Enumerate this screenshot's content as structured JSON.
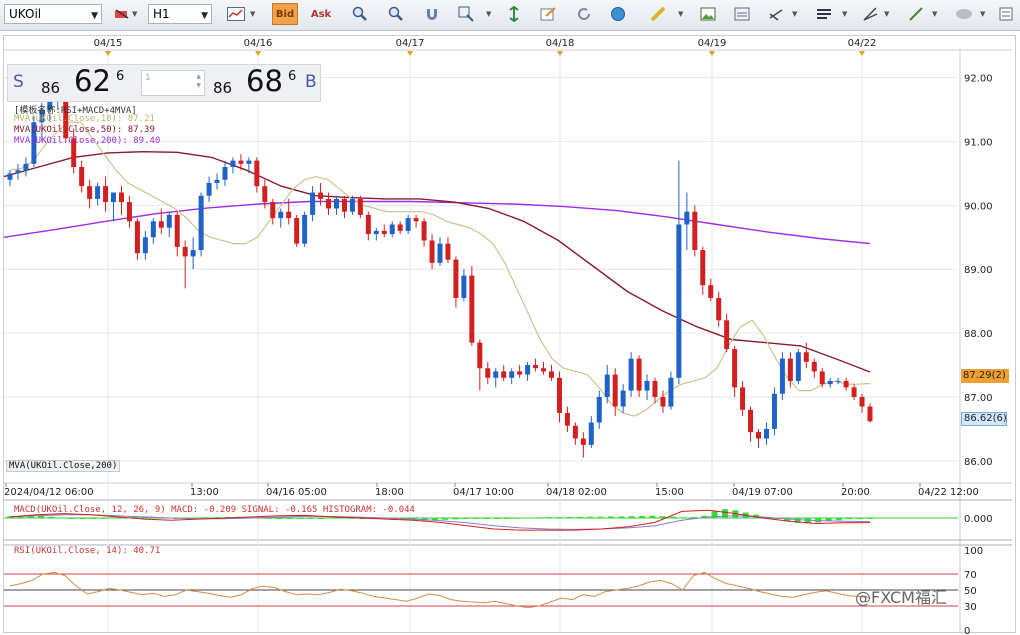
{
  "toolbar": {
    "symbol": "UKOil",
    "timeframe": "H1",
    "bid_label": "Bid",
    "ask_label": "Ask"
  },
  "quote": {
    "sell_label": "S",
    "sell_small": "86",
    "sell_big": "62",
    "sell_sup": "6",
    "lot_value": "1",
    "buy_small": "86",
    "buy_big": "68",
    "buy_sup": "6",
    "buy_label": "B"
  },
  "indicators": {
    "template": "[模板名称:RSI+MACD+4MVA]",
    "mva10": "MVA(UKOil.Close,10): 87.21",
    "mva50": "MVA(UKOil.Close,50): 87.39",
    "mva200": "MVA(UKOil.Close,200): 89.40",
    "mva200_tag": "MVA(UKOil.Close,200)",
    "macd": "MACD(UKOil.Close, 12, 26, 9)  MACD: -0.209  SIGNAL: -0.165  HISTOGRAM: -0.044",
    "rsi": "RSI(UKOil.Close, 14): 40.71"
  },
  "colors": {
    "bull": "#1f63c8",
    "bear": "#d21f1f",
    "mva10": "#c9c48f",
    "mva50": "#8b1a2e",
    "mva200": "#9b2de6",
    "macd_hist": "#33dd33",
    "signal": "#8a7ad0",
    "rsi": "#d88a4a"
  },
  "price_axis": [
    "92.00",
    "91.00",
    "90.00",
    "89.00",
    "88.00",
    "87.00",
    "86.00"
  ],
  "price_tags": {
    "mva": "87.29(2)",
    "last": "86.62(6)"
  },
  "top_dates": [
    "04/15",
    "04/16",
    "04/17",
    "04/18",
    "04/19",
    "04/22"
  ],
  "time_labels": [
    "2024/04/12 06:00",
    "13:00",
    "04/16 05:00",
    "18:00",
    "04/17 10:00",
    "04/18 02:00",
    "15:00",
    "04/19 07:00",
    "20:00",
    "04/22 12:00"
  ],
  "macd_axis": [
    "0.000"
  ],
  "rsi_axis": [
    "100",
    "70",
    "50",
    "30",
    "0"
  ],
  "watermark": "@FXCM福汇",
  "chart_data": {
    "type": "candlestick",
    "title": "UKOil H1",
    "ylim": [
      85.7,
      92.4
    ],
    "levels": [
      "92.00",
      "91.00",
      "90.00",
      "89.00",
      "88.00",
      "87.00",
      "86.00"
    ],
    "candles": [
      {
        "o": 90.4,
        "h": 90.55,
        "l": 90.3,
        "c": 90.5
      },
      {
        "o": 90.5,
        "h": 90.65,
        "l": 90.4,
        "c": 90.55
      },
      {
        "o": 90.55,
        "h": 90.75,
        "l": 90.45,
        "c": 90.65
      },
      {
        "o": 90.65,
        "h": 91.4,
        "l": 90.6,
        "c": 91.3
      },
      {
        "o": 91.3,
        "h": 91.6,
        "l": 91.0,
        "c": 91.5
      },
      {
        "o": 91.5,
        "h": 91.85,
        "l": 91.3,
        "c": 91.7
      },
      {
        "o": 91.7,
        "h": 92.2,
        "l": 91.5,
        "c": 92.0
      },
      {
        "o": 92.0,
        "h": 92.1,
        "l": 91.0,
        "c": 91.05
      },
      {
        "o": 91.05,
        "h": 91.2,
        "l": 90.5,
        "c": 90.6
      },
      {
        "o": 90.6,
        "h": 90.7,
        "l": 90.2,
        "c": 90.3
      },
      {
        "o": 90.3,
        "h": 90.4,
        "l": 89.95,
        "c": 90.1
      },
      {
        "o": 90.1,
        "h": 90.35,
        "l": 90.0,
        "c": 90.3
      },
      {
        "o": 90.3,
        "h": 90.45,
        "l": 89.9,
        "c": 90.05
      },
      {
        "o": 90.05,
        "h": 90.2,
        "l": 89.75,
        "c": 90.2
      },
      {
        "o": 90.2,
        "h": 90.3,
        "l": 89.85,
        "c": 90.05
      },
      {
        "o": 90.05,
        "h": 90.15,
        "l": 89.65,
        "c": 89.75
      },
      {
        "o": 89.75,
        "h": 89.8,
        "l": 89.15,
        "c": 89.25
      },
      {
        "o": 89.25,
        "h": 89.6,
        "l": 89.15,
        "c": 89.5
      },
      {
        "o": 89.5,
        "h": 89.8,
        "l": 89.4,
        "c": 89.75
      },
      {
        "o": 89.75,
        "h": 89.95,
        "l": 89.55,
        "c": 89.65
      },
      {
        "o": 89.65,
        "h": 89.9,
        "l": 89.5,
        "c": 89.85
      },
      {
        "o": 89.85,
        "h": 89.9,
        "l": 89.2,
        "c": 89.35
      },
      {
        "o": 89.35,
        "h": 89.45,
        "l": 88.7,
        "c": 89.2
      },
      {
        "o": 89.2,
        "h": 89.5,
        "l": 89.0,
        "c": 89.3
      },
      {
        "o": 89.3,
        "h": 90.2,
        "l": 89.2,
        "c": 90.15
      },
      {
        "o": 90.15,
        "h": 90.45,
        "l": 90.05,
        "c": 90.35
      },
      {
        "o": 90.35,
        "h": 90.5,
        "l": 90.25,
        "c": 90.4
      },
      {
        "o": 90.4,
        "h": 90.7,
        "l": 90.3,
        "c": 90.6
      },
      {
        "o": 90.6,
        "h": 90.75,
        "l": 90.5,
        "c": 90.7
      },
      {
        "o": 90.7,
        "h": 90.8,
        "l": 90.55,
        "c": 90.65
      },
      {
        "o": 90.65,
        "h": 90.75,
        "l": 90.5,
        "c": 90.7
      },
      {
        "o": 90.7,
        "h": 90.75,
        "l": 90.2,
        "c": 90.3
      },
      {
        "o": 90.3,
        "h": 90.4,
        "l": 89.95,
        "c": 90.05
      },
      {
        "o": 90.05,
        "h": 90.1,
        "l": 89.7,
        "c": 89.8
      },
      {
        "o": 89.8,
        "h": 89.95,
        "l": 89.65,
        "c": 89.9
      },
      {
        "o": 89.9,
        "h": 90.1,
        "l": 89.7,
        "c": 89.8
      },
      {
        "o": 89.8,
        "h": 89.85,
        "l": 89.35,
        "c": 89.4
      },
      {
        "o": 89.4,
        "h": 89.9,
        "l": 89.35,
        "c": 89.85
      },
      {
        "o": 89.85,
        "h": 90.3,
        "l": 89.75,
        "c": 90.2
      },
      {
        "o": 90.2,
        "h": 90.35,
        "l": 90.0,
        "c": 90.1
      },
      {
        "o": 90.1,
        "h": 90.2,
        "l": 89.85,
        "c": 89.95
      },
      {
        "o": 89.95,
        "h": 90.15,
        "l": 89.85,
        "c": 90.1
      },
      {
        "o": 90.1,
        "h": 90.15,
        "l": 89.8,
        "c": 89.9
      },
      {
        "o": 89.9,
        "h": 90.15,
        "l": 89.85,
        "c": 90.1
      },
      {
        "o": 90.1,
        "h": 90.15,
        "l": 89.8,
        "c": 89.85
      },
      {
        "o": 89.85,
        "h": 89.9,
        "l": 89.45,
        "c": 89.55
      },
      {
        "o": 89.55,
        "h": 89.65,
        "l": 89.45,
        "c": 89.6
      },
      {
        "o": 89.6,
        "h": 89.7,
        "l": 89.5,
        "c": 89.55
      },
      {
        "o": 89.55,
        "h": 89.75,
        "l": 89.5,
        "c": 89.7
      },
      {
        "o": 89.7,
        "h": 89.75,
        "l": 89.55,
        "c": 89.6
      },
      {
        "o": 89.6,
        "h": 89.85,
        "l": 89.55,
        "c": 89.8
      },
      {
        "o": 89.8,
        "h": 89.85,
        "l": 89.65,
        "c": 89.75
      },
      {
        "o": 89.75,
        "h": 89.8,
        "l": 89.35,
        "c": 89.45
      },
      {
        "o": 89.45,
        "h": 89.55,
        "l": 89.0,
        "c": 89.1
      },
      {
        "o": 89.1,
        "h": 89.5,
        "l": 89.05,
        "c": 89.4
      },
      {
        "o": 89.4,
        "h": 89.5,
        "l": 89.1,
        "c": 89.15
      },
      {
        "o": 89.15,
        "h": 89.2,
        "l": 88.4,
        "c": 88.55
      },
      {
        "o": 88.55,
        "h": 89.0,
        "l": 88.5,
        "c": 88.9
      },
      {
        "o": 88.9,
        "h": 89.05,
        "l": 87.8,
        "c": 87.85
      },
      {
        "o": 87.85,
        "h": 87.9,
        "l": 87.1,
        "c": 87.45
      },
      {
        "o": 87.45,
        "h": 87.55,
        "l": 87.2,
        "c": 87.3
      },
      {
        "o": 87.3,
        "h": 87.45,
        "l": 87.15,
        "c": 87.4
      },
      {
        "o": 87.4,
        "h": 87.5,
        "l": 87.25,
        "c": 87.3
      },
      {
        "o": 87.3,
        "h": 87.45,
        "l": 87.2,
        "c": 87.4
      },
      {
        "o": 87.4,
        "h": 87.5,
        "l": 87.3,
        "c": 87.35
      },
      {
        "o": 87.35,
        "h": 87.55,
        "l": 87.25,
        "c": 87.5
      },
      {
        "o": 87.5,
        "h": 87.6,
        "l": 87.4,
        "c": 87.45
      },
      {
        "o": 87.45,
        "h": 87.55,
        "l": 87.35,
        "c": 87.4
      },
      {
        "o": 87.4,
        "h": 87.5,
        "l": 87.25,
        "c": 87.3
      },
      {
        "o": 87.3,
        "h": 87.4,
        "l": 86.6,
        "c": 86.75
      },
      {
        "o": 86.75,
        "h": 86.85,
        "l": 86.45,
        "c": 86.55
      },
      {
        "o": 86.55,
        "h": 86.6,
        "l": 86.25,
        "c": 86.35
      },
      {
        "o": 86.35,
        "h": 86.45,
        "l": 86.05,
        "c": 86.25
      },
      {
        "o": 86.25,
        "h": 86.7,
        "l": 86.2,
        "c": 86.6
      },
      {
        "o": 86.6,
        "h": 87.1,
        "l": 86.5,
        "c": 87.0
      },
      {
        "o": 87.0,
        "h": 87.5,
        "l": 86.9,
        "c": 87.35
      },
      {
        "o": 87.35,
        "h": 87.45,
        "l": 86.7,
        "c": 86.85
      },
      {
        "o": 86.85,
        "h": 87.2,
        "l": 86.75,
        "c": 87.1
      },
      {
        "o": 87.1,
        "h": 87.7,
        "l": 87.0,
        "c": 87.6
      },
      {
        "o": 87.6,
        "h": 87.65,
        "l": 87.0,
        "c": 87.1
      },
      {
        "o": 87.1,
        "h": 87.35,
        "l": 86.95,
        "c": 87.25
      },
      {
        "o": 87.25,
        "h": 87.3,
        "l": 86.9,
        "c": 87.0
      },
      {
        "o": 87.0,
        "h": 87.1,
        "l": 86.75,
        "c": 86.85
      },
      {
        "o": 86.85,
        "h": 87.4,
        "l": 86.8,
        "c": 87.3
      },
      {
        "o": 87.3,
        "h": 90.7,
        "l": 87.2,
        "c": 89.7
      },
      {
        "o": 89.7,
        "h": 90.2,
        "l": 89.3,
        "c": 89.9
      },
      {
        "o": 89.9,
        "h": 90.0,
        "l": 89.2,
        "c": 89.3
      },
      {
        "o": 89.3,
        "h": 89.35,
        "l": 88.6,
        "c": 88.75
      },
      {
        "o": 88.75,
        "h": 88.85,
        "l": 88.5,
        "c": 88.55
      },
      {
        "o": 88.55,
        "h": 88.65,
        "l": 88.1,
        "c": 88.2
      },
      {
        "o": 88.2,
        "h": 88.3,
        "l": 87.7,
        "c": 87.75
      },
      {
        "o": 87.75,
        "h": 87.8,
        "l": 87.0,
        "c": 87.15
      },
      {
        "o": 87.15,
        "h": 87.25,
        "l": 86.7,
        "c": 86.8
      },
      {
        "o": 86.8,
        "h": 86.85,
        "l": 86.3,
        "c": 86.45
      },
      {
        "o": 86.45,
        "h": 86.5,
        "l": 86.2,
        "c": 86.35
      },
      {
        "o": 86.35,
        "h": 86.6,
        "l": 86.25,
        "c": 86.5
      },
      {
        "o": 86.5,
        "h": 87.15,
        "l": 86.4,
        "c": 87.05
      },
      {
        "o": 87.05,
        "h": 87.7,
        "l": 86.95,
        "c": 87.6
      },
      {
        "o": 87.6,
        "h": 87.7,
        "l": 87.15,
        "c": 87.25
      },
      {
        "o": 87.25,
        "h": 87.75,
        "l": 87.2,
        "c": 87.7
      },
      {
        "o": 87.7,
        "h": 87.85,
        "l": 87.45,
        "c": 87.55
      },
      {
        "o": 87.55,
        "h": 87.6,
        "l": 87.3,
        "c": 87.4
      },
      {
        "o": 87.4,
        "h": 87.45,
        "l": 87.15,
        "c": 87.2
      },
      {
        "o": 87.2,
        "h": 87.3,
        "l": 87.15,
        "c": 87.25
      },
      {
        "o": 87.25,
        "h": 87.3,
        "l": 87.2,
        "c": 87.25
      },
      {
        "o": 87.25,
        "h": 87.3,
        "l": 87.1,
        "c": 87.15
      },
      {
        "o": 87.15,
        "h": 87.2,
        "l": 86.95,
        "c": 87.0
      },
      {
        "o": 87.0,
        "h": 87.05,
        "l": 86.75,
        "c": 86.85
      },
      {
        "o": 86.85,
        "h": 86.9,
        "l": 86.6,
        "c": 86.62
      }
    ],
    "mva10": [
      90.55,
      90.58,
      90.7,
      90.95,
      91.15,
      91.3,
      91.3,
      91.05,
      90.8,
      90.55,
      90.35,
      90.25,
      90.15,
      90.05,
      89.95,
      89.8,
      89.6,
      89.5,
      89.45,
      89.4,
      89.4,
      89.5,
      89.75,
      90.0,
      90.25,
      90.4,
      90.45,
      90.4,
      90.25,
      90.1,
      90.0,
      89.95,
      89.9,
      89.9,
      89.9,
      89.9,
      89.85,
      89.75,
      89.7,
      89.65,
      89.55,
      89.4,
      89.1,
      88.7,
      88.3,
      87.9,
      87.6,
      87.45,
      87.4,
      87.35,
      87.15,
      86.9,
      86.75,
      86.7,
      86.8,
      86.95,
      87.1,
      87.2,
      87.25,
      87.3,
      87.45,
      87.8,
      88.1,
      88.2,
      87.95,
      87.6,
      87.3,
      87.1,
      87.1,
      87.2,
      87.25,
      87.2,
      87.2,
      87.21
    ],
    "mva50": [
      90.45,
      90.6,
      90.75,
      90.82,
      90.84,
      90.83,
      90.75,
      90.55,
      90.3,
      90.15,
      90.12,
      90.1,
      90.1,
      90.05,
      89.95,
      89.75,
      89.45,
      89.05,
      88.65,
      88.35,
      88.1,
      87.9,
      87.85,
      87.8,
      87.6,
      87.39
    ],
    "mva200": [
      89.5,
      89.62,
      89.75,
      89.87,
      89.96,
      90.02,
      90.06,
      90.06,
      90.06,
      90.04,
      90.02,
      89.98,
      89.92,
      89.82,
      89.7,
      89.58,
      89.48,
      89.4
    ],
    "macd_hist": [
      0.08,
      0.1,
      0.12,
      0.1,
      0.06,
      0.02,
      -0.02,
      -0.03,
      -0.02,
      0.01,
      0.03,
      0.04,
      0.05,
      0.05,
      0.04,
      0.02,
      0.0,
      -0.01,
      0.01,
      0.03,
      0.04,
      0.05,
      0.05,
      0.04,
      0.03,
      0.01,
      0.0,
      -0.02,
      -0.03,
      -0.02,
      0.0,
      0.02,
      0.02,
      0.01,
      0.0,
      0.0,
      -0.02,
      -0.05,
      -0.08,
      -0.1,
      -0.11,
      -0.1,
      -0.08,
      -0.06,
      -0.04,
      -0.03,
      -0.02,
      -0.01,
      0.0,
      0.01,
      0.02,
      0.03,
      0.04,
      0.04,
      0.05,
      0.05,
      0.06,
      0.06,
      0.07,
      0.07,
      0.08,
      0.09,
      0.1,
      0.08,
      0.06,
      0.03,
      0.04,
      0.1,
      0.3,
      0.4,
      0.35,
      0.25,
      0.15,
      0.05,
      -0.05,
      -0.15,
      -0.22,
      -0.25,
      -0.2,
      -0.15,
      -0.1,
      -0.05,
      -0.05,
      -0.04
    ],
    "macd_line": [
      0.05,
      0.15,
      0.2,
      0.15,
      0.05,
      -0.05,
      -0.1,
      -0.05,
      0.0,
      0.05,
      0.1,
      0.12,
      0.05,
      0.0,
      -0.05,
      -0.1,
      -0.2,
      -0.35,
      -0.5,
      -0.55,
      -0.55,
      -0.55,
      -0.5,
      -0.4,
      -0.2,
      0.3,
      0.35,
      0.2,
      0.0,
      -0.15,
      -0.25,
      -0.22,
      -0.21
    ],
    "signal_line": [
      0.05,
      0.1,
      0.15,
      0.15,
      0.1,
      0.05,
      0.0,
      -0.03,
      -0.03,
      0.0,
      0.04,
      0.08,
      0.07,
      0.04,
      0.0,
      -0.05,
      -0.12,
      -0.22,
      -0.35,
      -0.45,
      -0.5,
      -0.52,
      -0.5,
      -0.45,
      -0.35,
      -0.1,
      0.05,
      0.1,
      0.05,
      -0.05,
      -0.12,
      -0.15,
      -0.165
    ],
    "rsi": [
      55,
      58,
      62,
      70,
      72,
      68,
      55,
      45,
      48,
      52,
      50,
      47,
      44,
      46,
      42,
      44,
      50,
      48,
      46,
      43,
      41,
      44,
      52,
      55,
      53,
      48,
      44,
      45,
      44,
      47,
      51,
      49,
      46,
      42,
      40,
      38,
      36,
      40,
      45,
      43,
      38,
      36,
      35,
      34,
      36,
      33,
      30,
      28,
      30,
      35,
      40,
      38,
      44,
      42,
      48,
      50,
      52,
      55,
      60,
      62,
      58,
      50,
      68,
      72,
      64,
      58,
      55,
      52,
      48,
      45,
      42,
      41,
      44,
      47,
      49,
      46,
      43,
      42,
      40.71
    ],
    "rsi_levels": [
      "70",
      "50",
      "30"
    ]
  }
}
